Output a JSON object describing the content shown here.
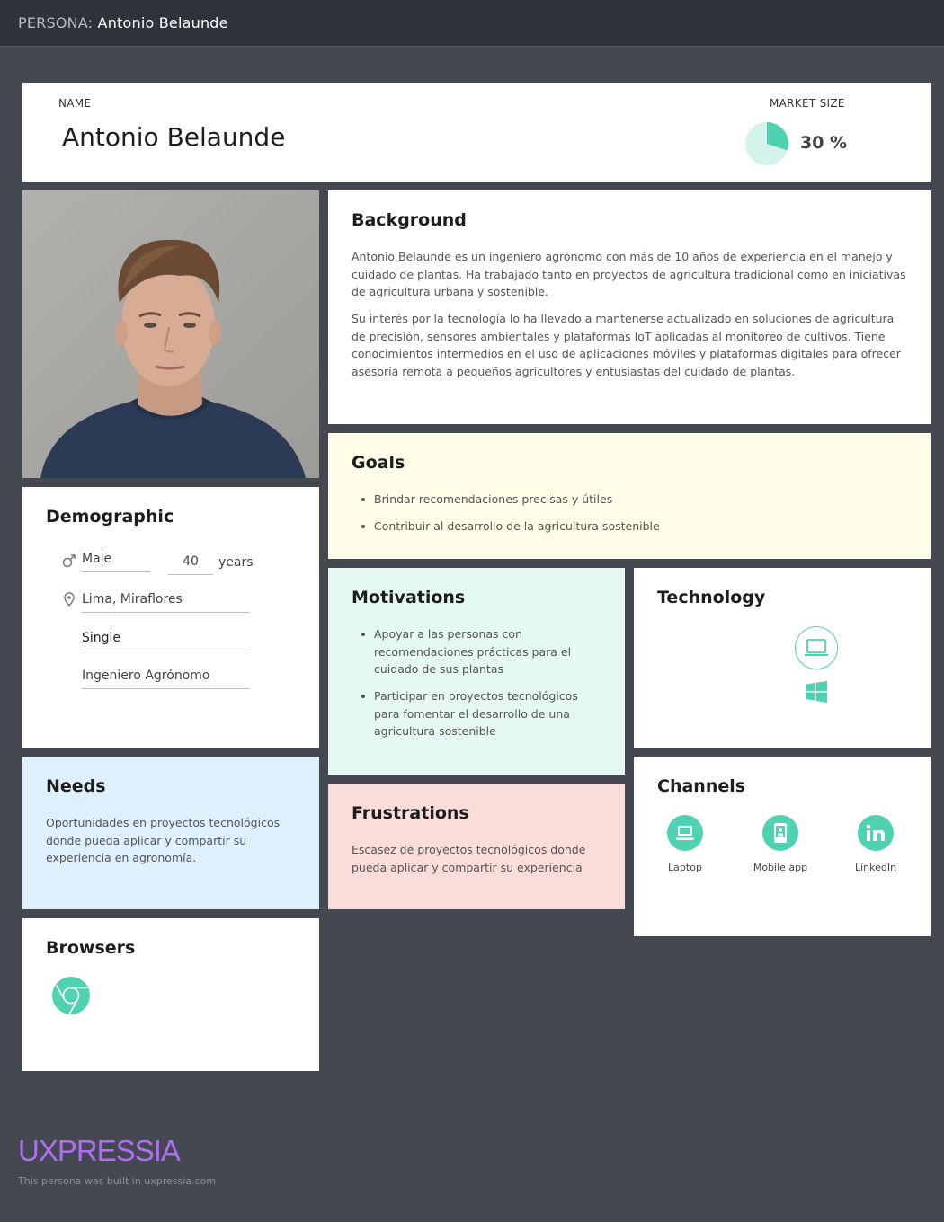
{
  "header": {
    "prefix": "PERSONA:",
    "name": "Antonio Belaunde"
  },
  "name_card": {
    "name_label": "NAME",
    "name": "Antonio Belaunde",
    "market_label": "MARKET SIZE",
    "market_value": "30 %",
    "market_fraction": 0.3
  },
  "background": {
    "title": "Background",
    "paragraphs": [
      "Antonio Belaunde es un ingeniero agrónomo con más de 10 años de experiencia en el manejo y cuidado de plantas. Ha trabajado tanto en proyectos de agricultura tradicional como en iniciativas de agricultura urbana y sostenible.",
      "Su interés por la tecnología lo ha llevado a mantenerse actualizado en soluciones de agricultura de precisión, sensores ambientales y plataformas IoT aplicadas al monitoreo de cultivos. Tiene conocimientos intermedios en el uso de aplicaciones móviles y plataformas digitales para ofrecer asesoría remota a pequeños agricultores y entusiastas del cuidado de plantas."
    ]
  },
  "goals": {
    "title": "Goals",
    "items": [
      "Brindar recomendaciones precisas y útiles",
      "Contribuir al desarrollo de la agricultura sostenible"
    ]
  },
  "demographic": {
    "title": "Demographic",
    "gender": "Male",
    "age": "40",
    "age_unit": "years",
    "location": "Lima, Miraflores",
    "status": "Single",
    "occupation": "Ingeniero Agrónomo"
  },
  "motivations": {
    "title": "Motivations",
    "items": [
      "Apoyar a las personas con recomendaciones prácticas para el cuidado de sus plantas",
      "Participar en proyectos tecnológicos para fomentar el desarrollo de una agricultura sostenible"
    ]
  },
  "technology": {
    "title": "Technology",
    "icons": [
      "laptop-icon",
      "windows-icon"
    ]
  },
  "needs": {
    "title": "Needs",
    "text": "Oportunidades en proyectos tecnológicos donde pueda aplicar y compartir su experiencia en agronomía."
  },
  "frustrations": {
    "title": "Frustrations",
    "text": "Escasez de proyectos tecnológicos donde pueda aplicar y compartir su experiencia"
  },
  "channels": {
    "title": "Channels",
    "items": [
      {
        "label": "Laptop",
        "icon": "laptop-icon"
      },
      {
        "label": "Mobile app",
        "icon": "mobile-app-icon"
      },
      {
        "label": "LinkedIn",
        "icon": "linkedin-icon"
      }
    ]
  },
  "browsers": {
    "title": "Browsers",
    "icons": [
      "chrome-icon"
    ]
  },
  "footer": {
    "logo": "UXPRESSIA",
    "note": "This persona was built in uxpressia.com"
  },
  "colors": {
    "accent": "#4fd2b1",
    "background": "#444851",
    "header": "#2f323a",
    "goals_bg": "#fefde8",
    "motivations_bg": "#e6f8f3",
    "needs_bg": "#dff0fd",
    "frustrations_bg": "#fadcd8",
    "logo": "#b06ef0"
  }
}
